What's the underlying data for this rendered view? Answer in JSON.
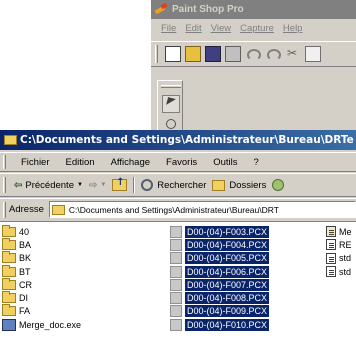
{
  "psp": {
    "title": "Paint Shop Pro",
    "menu": [
      "File",
      "Edit",
      "View",
      "Capture",
      "Help"
    ]
  },
  "explorer": {
    "title": "C:\\Documents and Settings\\Administrateur\\Bureau\\DRTe",
    "menu": [
      "Fichier",
      "Edition",
      "Affichage",
      "Favoris",
      "Outils",
      "?"
    ],
    "toolbar": {
      "back_label": "Précédente",
      "search_label": "Rechercher",
      "folders_label": "Dossiers"
    },
    "address": {
      "label": "Adresse",
      "value": "C:\\Documents and Settings\\Administrateur\\Bureau\\DRT"
    },
    "folders": [
      "40",
      "BA",
      "BK",
      "BT",
      "CR",
      "DI",
      "FA"
    ],
    "document_file": "Merge_doc.exe",
    "pcx_files": [
      "D00-(04)-F003.PCX",
      "D00-(04)-F004.PCX",
      "D00-(04)-F005.PCX",
      "D00-(04)-F006.PCX",
      "D00-(04)-F007.PCX",
      "D00-(04)-F008.PCX",
      "D00-(04)-F009.PCX",
      "D00-(04)-F010.PCX"
    ],
    "misc_files": [
      "Me",
      "RE",
      "std",
      "std"
    ]
  }
}
